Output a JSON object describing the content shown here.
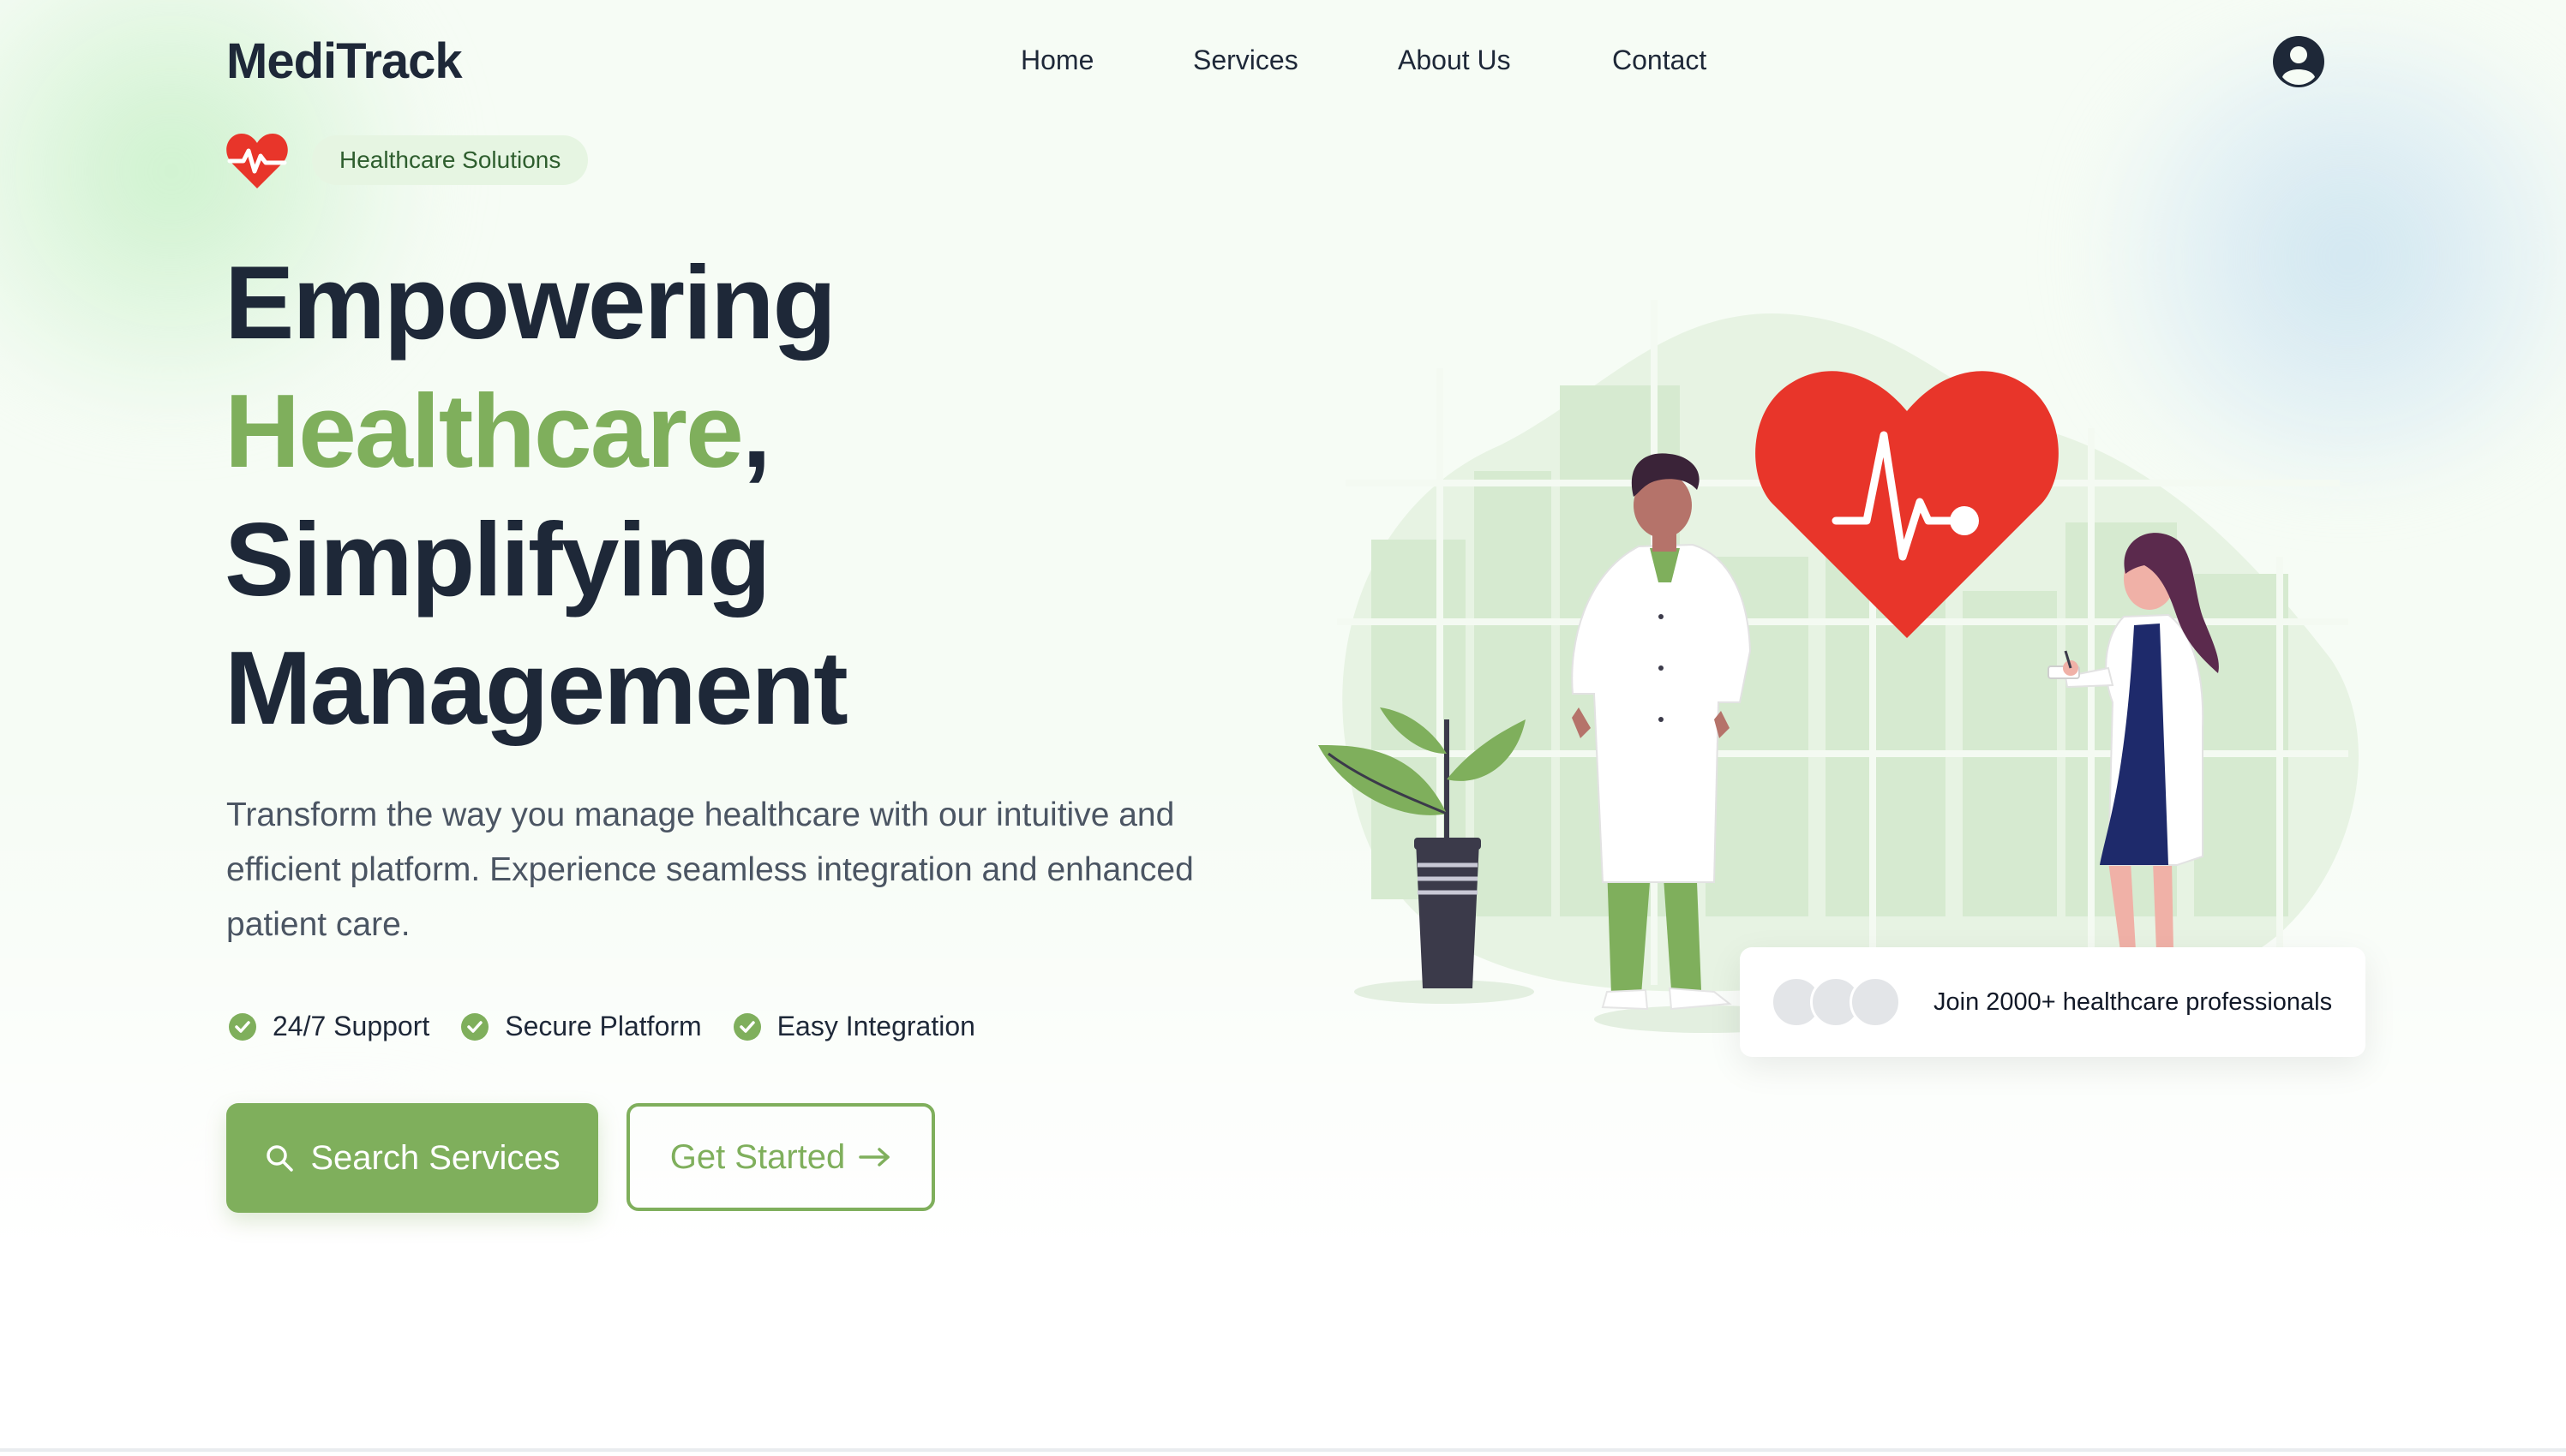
{
  "app": {
    "logo": "MediTrack"
  },
  "nav": {
    "items": [
      "Home",
      "Services",
      "About Us",
      "Contact"
    ]
  },
  "hero": {
    "badge": "Healthcare Solutions",
    "headline": {
      "line1": "Empowering",
      "line2_accent": "Healthcare",
      "line2_suffix": ",",
      "line3": "Simplifying",
      "line4": "Management"
    },
    "description": "Transform the way you manage healthcare with our intuitive and efficient platform. Experience seamless integration and enhanced patient care.",
    "features": [
      "24/7 Support",
      "Secure Platform",
      "Easy Integration"
    ],
    "primary_button": "Search Services",
    "secondary_button": "Get Started"
  },
  "social_proof": {
    "text": "Join 2000+ healthcare professionals"
  },
  "icons": {
    "user": "user-circle-icon",
    "badge": "heart-pulse-icon",
    "check": "check-circle-icon",
    "search": "search-icon",
    "arrow": "arrow-right-icon"
  },
  "colors": {
    "accent": "#7faf5c",
    "heart": "#e8352a",
    "text": "#1e2838",
    "badge_bg": "#e6f5e2"
  }
}
